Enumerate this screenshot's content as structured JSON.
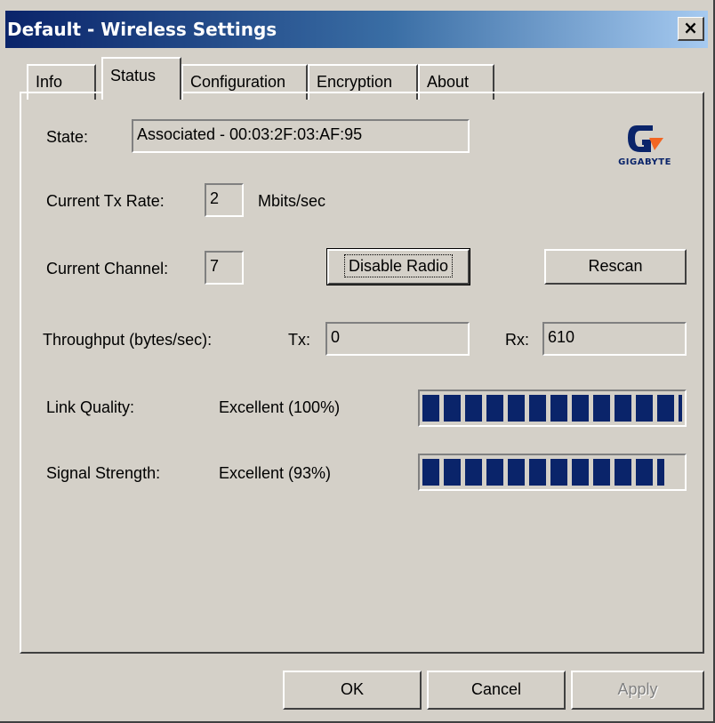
{
  "window": {
    "title": "Default - Wireless Settings",
    "close_glyph": "×"
  },
  "tabs": [
    {
      "label": "Info",
      "active": false
    },
    {
      "label": "Status",
      "active": true
    },
    {
      "label": "Configuration",
      "active": false
    },
    {
      "label": "Encryption",
      "active": false
    },
    {
      "label": "About",
      "active": false
    }
  ],
  "logo": {
    "text": "GIGABYTE",
    "colors": {
      "blue": "#0a246a",
      "orange": "#f26522"
    }
  },
  "status": {
    "state_label": "State:",
    "state_value": "Associated - 00:03:2F:03:AF:95",
    "tx_rate_label": "Current Tx Rate:",
    "tx_rate_value": "2",
    "tx_rate_unit": "Mbits/sec",
    "channel_label": "Current Channel:",
    "channel_value": "7",
    "disable_radio_label": "Disable Radio",
    "rescan_label": "Rescan",
    "throughput_label": "Throughput (bytes/sec):",
    "tx_label": "Tx:",
    "tx_value": "0",
    "rx_label": "Rx:",
    "rx_value": "610",
    "link_quality_label": "Link Quality:",
    "link_quality_text": "Excellent (100%)",
    "link_quality_level": 1.0,
    "signal_strength_label": "Signal Strength:",
    "signal_strength_text": "Excellent (93%)",
    "signal_strength_level": 0.93
  },
  "buttons": {
    "ok": "OK",
    "cancel": "Cancel",
    "apply": "Apply"
  },
  "colors": {
    "titlebar": "#0a246a",
    "face": "#d4d0c8",
    "meter": "#0a246a"
  }
}
